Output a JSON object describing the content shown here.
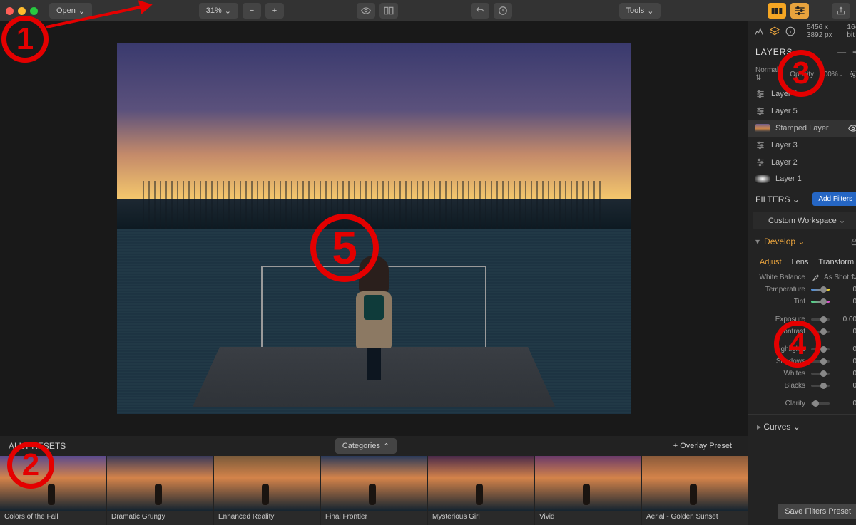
{
  "toolbar": {
    "open": "Open",
    "zoom": "31%",
    "tools": "Tools"
  },
  "meta": {
    "dimensions": "5456 x 3892 px",
    "depth": "16-bit"
  },
  "layers": {
    "title": "LAYERS",
    "blend": "Normal",
    "opacity_label": "Opacity",
    "opacity_value": "100%",
    "items": [
      {
        "name": "Layer 4",
        "type": "adj"
      },
      {
        "name": "Layer 5",
        "type": "adj"
      },
      {
        "name": "Stamped Layer",
        "type": "img",
        "selected": true
      },
      {
        "name": "Layer 3",
        "type": "adj"
      },
      {
        "name": "Layer 2",
        "type": "adj"
      },
      {
        "name": "Layer 1",
        "type": "mask"
      }
    ]
  },
  "filters": {
    "title": "FILTERS",
    "add": "Add Filters",
    "workspace": "Custom Workspace"
  },
  "develop": {
    "title": "Develop",
    "tabs": [
      "Adjust",
      "Lens",
      "Transform"
    ],
    "active_tab": "Adjust",
    "wb_label": "White Balance",
    "wb_mode": "As Shot",
    "sliders": [
      {
        "label": "Temperature",
        "value": "0",
        "knob": 50,
        "class": "temp"
      },
      {
        "label": "Tint",
        "value": "0",
        "knob": 50,
        "class": "tint"
      },
      {
        "label": "Exposure",
        "value": "0.00",
        "knob": 50
      },
      {
        "label": "Contrast",
        "value": "0",
        "knob": 50
      },
      {
        "label": "Highlights",
        "value": "0",
        "knob": 50
      },
      {
        "label": "Shadows",
        "value": "0",
        "knob": 50
      },
      {
        "label": "Whites",
        "value": "0",
        "knob": 50
      },
      {
        "label": "Blacks",
        "value": "0",
        "knob": 50
      },
      {
        "label": "Clarity",
        "value": "0",
        "knob": 6
      }
    ],
    "curves": "Curves",
    "save_preset": "Save Filters Preset"
  },
  "presets": {
    "all_label": "ALL PRESETS",
    "categories": "Categories",
    "overlay": "+ Overlay Preset",
    "items": [
      "Colors of the Fall",
      "Dramatic Grungy",
      "Enhanced Reality",
      "Final Frontier",
      "Mysterious Girl",
      "Vivid",
      "Aerial - Golden Sunset"
    ]
  },
  "annotations": [
    "1",
    "2",
    "3",
    "4",
    "5"
  ]
}
